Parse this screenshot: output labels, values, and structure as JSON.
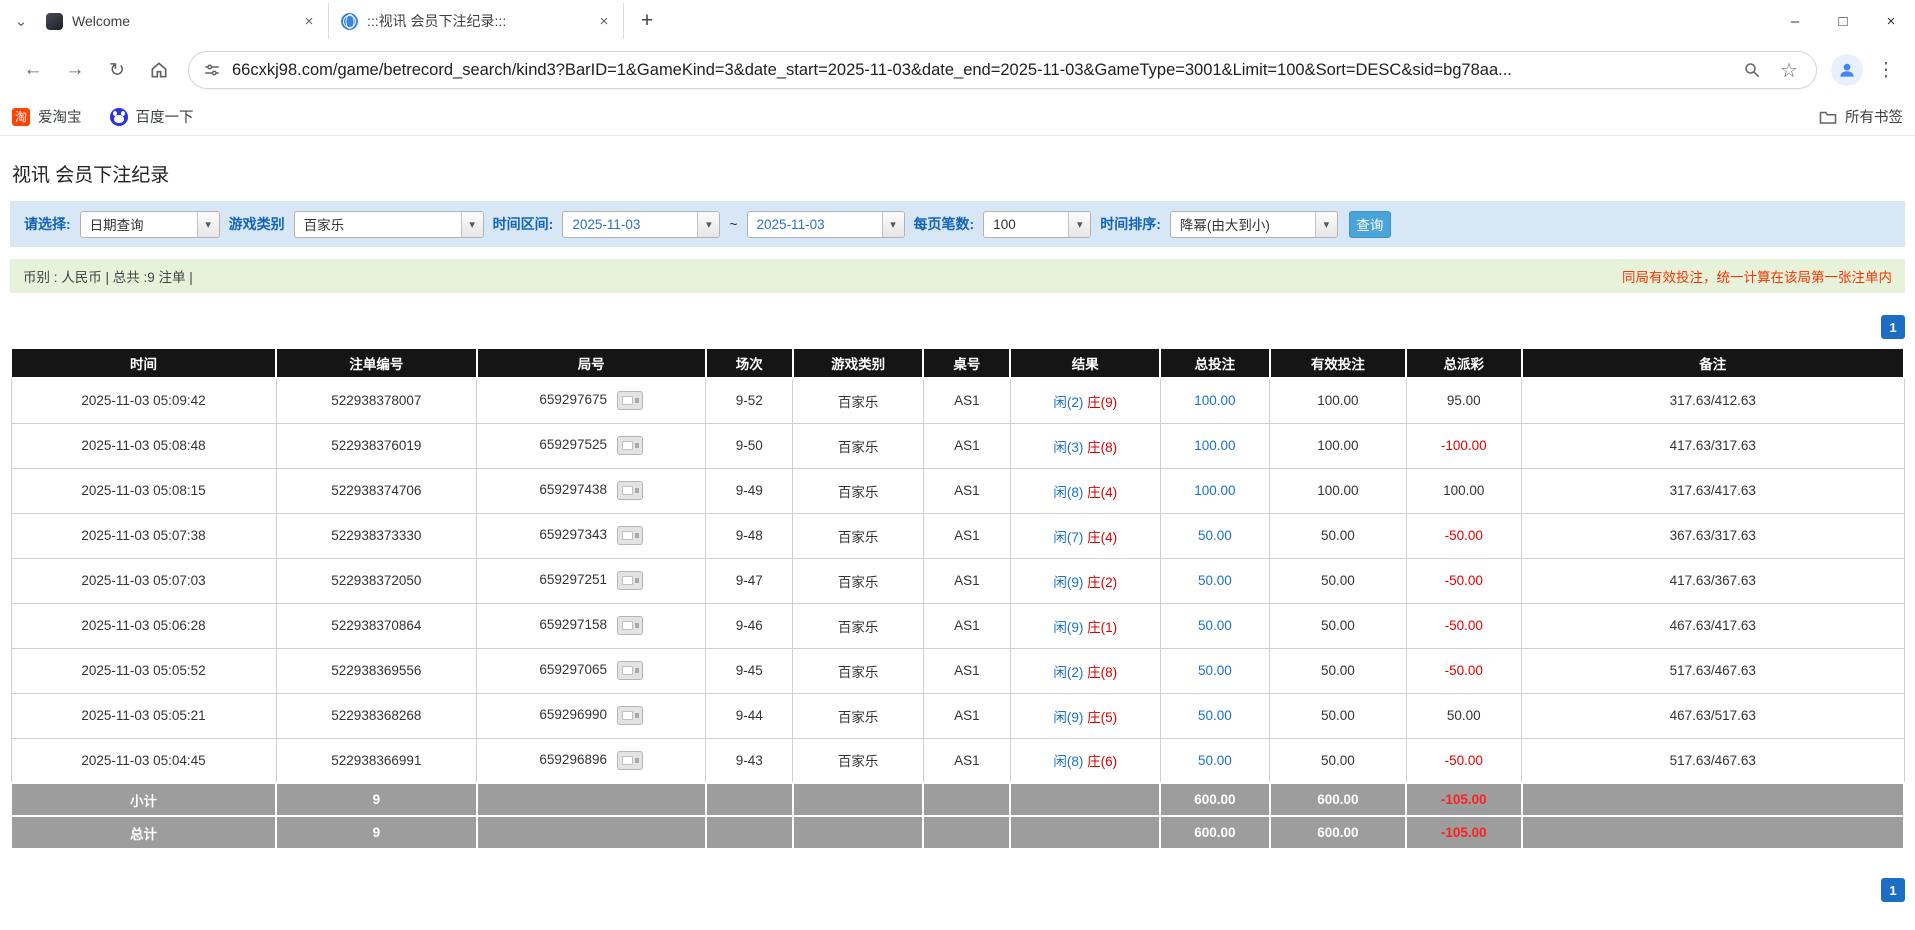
{
  "browser": {
    "tabs": [
      {
        "label": "Welcome"
      },
      {
        "label": ":::视讯 会员下注纪录:::"
      }
    ],
    "url": "66cxkj98.com/game/betrecord_search/kind3?BarID=1&GameKind=3&date_start=2025-11-03&date_end=2025-11-03&GameType=3001&Limit=100&Sort=DESC&sid=bg78aa...",
    "bookmarks": {
      "aitaobao": "爱淘宝",
      "baidu": "百度一下",
      "all_bookmarks": "所有书签"
    }
  },
  "icons": {
    "tab_search": "⌄",
    "tab_close": "×",
    "new_tab": "+",
    "minimize": "–",
    "maximize": "□",
    "window_close": "×",
    "back": "←",
    "forward": "→",
    "reload": "↻",
    "star": "☆",
    "menu": "⋮",
    "combo_arrow": "▾"
  },
  "page": {
    "title": "视讯 会员下注纪录",
    "filter": {
      "select_label": "请选择:",
      "select_value": "日期查询",
      "game_label": "游戏类别",
      "game_value": "百家乐",
      "range_label": "时间区间:",
      "date_start": "2025-11-03",
      "range_separator": "~",
      "date_end": "2025-11-03",
      "per_page_label": "每页笔数:",
      "per_page_value": "100",
      "sort_label": "时间排序:",
      "sort_value": "降幂(由大到小)",
      "search_button": "查询"
    },
    "info": {
      "summary": "币别 : 人民币 | 总共 :9 注单 |",
      "notice": "同局有效投注，统一计算在该局第一张注单内"
    },
    "pagination": {
      "current": "1"
    },
    "table": {
      "headers": [
        "时间",
        "注单编号",
        "局号",
        "场次",
        "游戏类别",
        "桌号",
        "结果",
        "总投注",
        "有效投注",
        "总派彩",
        "备注"
      ],
      "rows": [
        {
          "time": "2025-11-03 05:09:42",
          "bet_id": "522938378007",
          "round": "659297675",
          "session": "9-52",
          "game": "百家乐",
          "table": "AS1",
          "player": "闲(2)",
          "banker": "庄(9)",
          "total_bet": "100.00",
          "valid_bet": "100.00",
          "payout": "95.00",
          "note": "317.63/412.63"
        },
        {
          "time": "2025-11-03 05:08:48",
          "bet_id": "522938376019",
          "round": "659297525",
          "session": "9-50",
          "game": "百家乐",
          "table": "AS1",
          "player": "闲(3)",
          "banker": "庄(8)",
          "total_bet": "100.00",
          "valid_bet": "100.00",
          "payout": "-100.00",
          "note": "417.63/317.63"
        },
        {
          "time": "2025-11-03 05:08:15",
          "bet_id": "522938374706",
          "round": "659297438",
          "session": "9-49",
          "game": "百家乐",
          "table": "AS1",
          "player": "闲(8)",
          "banker": "庄(4)",
          "total_bet": "100.00",
          "valid_bet": "100.00",
          "payout": "100.00",
          "note": "317.63/417.63"
        },
        {
          "time": "2025-11-03 05:07:38",
          "bet_id": "522938373330",
          "round": "659297343",
          "session": "9-48",
          "game": "百家乐",
          "table": "AS1",
          "player": "闲(7)",
          "banker": "庄(4)",
          "total_bet": "50.00",
          "valid_bet": "50.00",
          "payout": "-50.00",
          "note": "367.63/317.63"
        },
        {
          "time": "2025-11-03 05:07:03",
          "bet_id": "522938372050",
          "round": "659297251",
          "session": "9-47",
          "game": "百家乐",
          "table": "AS1",
          "player": "闲(9)",
          "banker": "庄(2)",
          "total_bet": "50.00",
          "valid_bet": "50.00",
          "payout": "-50.00",
          "note": "417.63/367.63"
        },
        {
          "time": "2025-11-03 05:06:28",
          "bet_id": "522938370864",
          "round": "659297158",
          "session": "9-46",
          "game": "百家乐",
          "table": "AS1",
          "player": "闲(9)",
          "banker": "庄(1)",
          "total_bet": "50.00",
          "valid_bet": "50.00",
          "payout": "-50.00",
          "note": "467.63/417.63"
        },
        {
          "time": "2025-11-03 05:05:52",
          "bet_id": "522938369556",
          "round": "659297065",
          "session": "9-45",
          "game": "百家乐",
          "table": "AS1",
          "player": "闲(2)",
          "banker": "庄(8)",
          "total_bet": "50.00",
          "valid_bet": "50.00",
          "payout": "-50.00",
          "note": "517.63/467.63"
        },
        {
          "time": "2025-11-03 05:05:21",
          "bet_id": "522938368268",
          "round": "659296990",
          "session": "9-44",
          "game": "百家乐",
          "table": "AS1",
          "player": "闲(9)",
          "banker": "庄(5)",
          "total_bet": "50.00",
          "valid_bet": "50.00",
          "payout": "50.00",
          "note": "467.63/517.63"
        },
        {
          "time": "2025-11-03 05:04:45",
          "bet_id": "522938366991",
          "round": "659296896",
          "session": "9-43",
          "game": "百家乐",
          "table": "AS1",
          "player": "闲(8)",
          "banker": "庄(6)",
          "total_bet": "50.00",
          "valid_bet": "50.00",
          "payout": "-50.00",
          "note": "517.63/467.63"
        }
      ],
      "subtotal": {
        "label": "小计",
        "count": "9",
        "total_bet": "600.00",
        "valid_bet": "600.00",
        "payout": "-105.00"
      },
      "total": {
        "label": "总计",
        "count": "9",
        "total_bet": "600.00",
        "valid_bet": "600.00",
        "payout": "-105.00"
      }
    }
  },
  "colors": {
    "accent-blue": "#1b6fd0",
    "negative-red": "#e60000",
    "player-blue": "#1b6fd0",
    "banker-red": "#d90000",
    "header-bg": "#151515",
    "footer-bg": "#9d9d9d",
    "filter-bg": "#d7e7f6",
    "filter-label": "#1464b4",
    "info-bg": "#e6f3da",
    "notice-red": "#ff3300",
    "pager-bg": "#1d6ec2",
    "button-bg": "#4aa4d9"
  }
}
